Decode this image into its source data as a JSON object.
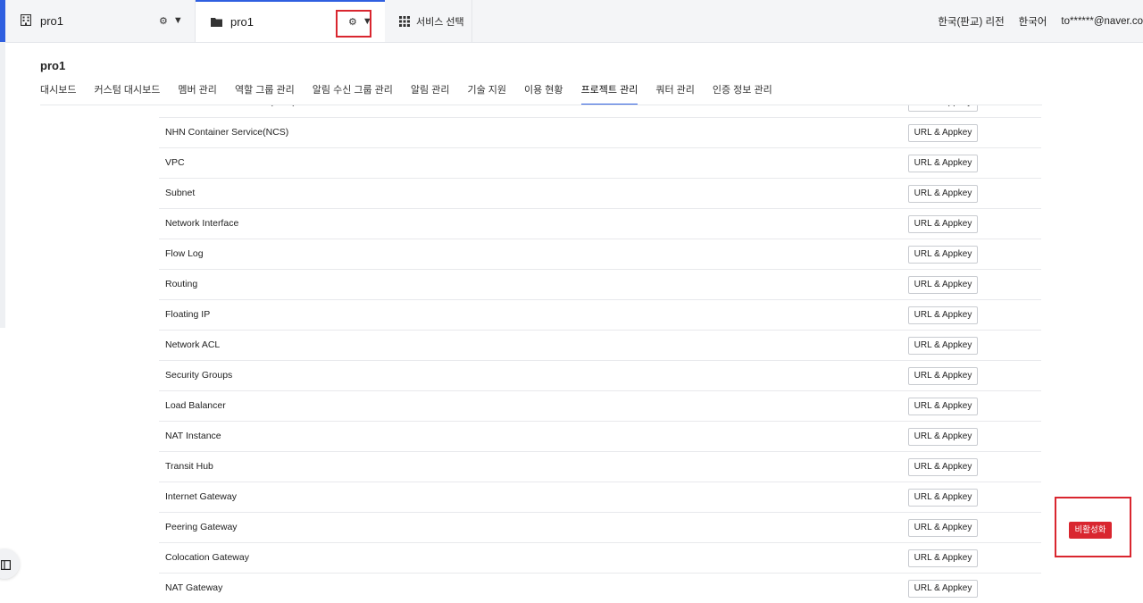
{
  "topbar": {
    "org_name": "pro1",
    "project_name": "pro1",
    "service_select_label": "서비스 선택",
    "region": "한국(판교) 리전",
    "language": "한국어",
    "user_email": "to******@naver.co"
  },
  "colors": {
    "accent": "#2f5fe0",
    "danger": "#d9262f",
    "highlight_box": "#d9262f"
  },
  "page": {
    "title": "pro1",
    "tabs": [
      {
        "label": "대시보드"
      },
      {
        "label": "커스텀 대시보드"
      },
      {
        "label": "멤버 관리"
      },
      {
        "label": "역할 그룹 관리"
      },
      {
        "label": "알림 수신 그룹 관리"
      },
      {
        "label": "알림 관리"
      },
      {
        "label": "기술 지원"
      },
      {
        "label": "이용 현황"
      },
      {
        "label": "프로젝트 관리",
        "active": true
      },
      {
        "label": "쿼터 관리"
      },
      {
        "label": "인증 정보 관리"
      }
    ]
  },
  "services": [
    {
      "name": "NHN Kubernetes Service(NKS)",
      "button": "URL & Appkey"
    },
    {
      "name": "NHN Container Service(NCS)",
      "button": "URL & Appkey"
    },
    {
      "name": "VPC",
      "button": "URL & Appkey"
    },
    {
      "name": "Subnet",
      "button": "URL & Appkey"
    },
    {
      "name": "Network Interface",
      "button": "URL & Appkey"
    },
    {
      "name": "Flow Log",
      "button": "URL & Appkey"
    },
    {
      "name": "Routing",
      "button": "URL & Appkey"
    },
    {
      "name": "Floating IP",
      "button": "URL & Appkey"
    },
    {
      "name": "Network ACL",
      "button": "URL & Appkey"
    },
    {
      "name": "Security Groups",
      "button": "URL & Appkey"
    },
    {
      "name": "Load Balancer",
      "button": "URL & Appkey"
    },
    {
      "name": "NAT Instance",
      "button": "URL & Appkey"
    },
    {
      "name": "Transit Hub",
      "button": "URL & Appkey"
    },
    {
      "name": "Internet Gateway",
      "button": "URL & Appkey"
    },
    {
      "name": "Peering Gateway",
      "button": "URL & Appkey"
    },
    {
      "name": "Colocation Gateway",
      "button": "URL & Appkey"
    },
    {
      "name": "NAT Gateway",
      "button": "URL & Appkey"
    }
  ],
  "deactivate_label": "비활성화",
  "icons": [
    "building-icon",
    "folder-icon",
    "gear-icon",
    "caret-down-icon",
    "grid-icon",
    "panel-toggle-icon"
  ]
}
